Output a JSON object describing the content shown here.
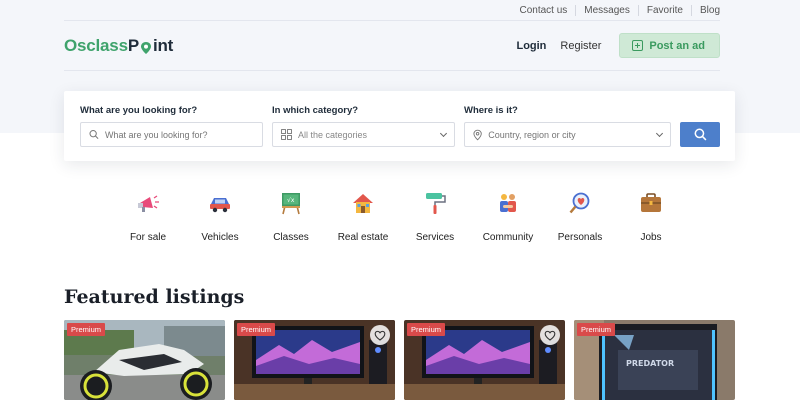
{
  "util_links": [
    "Contact us",
    "Messages",
    "Favorite",
    "Blog"
  ],
  "logo": {
    "part1": "Osclass",
    "part2": "P",
    "part3": "int"
  },
  "nav": {
    "login": "Login",
    "register": "Register",
    "post_ad": "Post an ad"
  },
  "search": {
    "what_label": "What are you looking for?",
    "what_placeholder": "What are you looking for?",
    "category_label": "In which category?",
    "category_value": "All the categories",
    "where_label": "Where is it?",
    "where_placeholder": "Country, region or city"
  },
  "categories": [
    {
      "label": "For sale",
      "icon": "megaphone-icon"
    },
    {
      "label": "Vehicles",
      "icon": "car-icon"
    },
    {
      "label": "Classes",
      "icon": "chalkboard-icon"
    },
    {
      "label": "Real estate",
      "icon": "house-icon"
    },
    {
      "label": "Services",
      "icon": "paint-roller-icon"
    },
    {
      "label": "Community",
      "icon": "people-icon"
    },
    {
      "label": "Personals",
      "icon": "heart-magnifier-icon"
    },
    {
      "label": "Jobs",
      "icon": "briefcase-icon"
    }
  ],
  "featured": {
    "title": "Featured listings",
    "listings": [
      {
        "badge": "Premium",
        "image": "motorcycle"
      },
      {
        "badge": "Premium",
        "image": "desk-setup"
      },
      {
        "badge": "Premium",
        "image": "desk-setup"
      },
      {
        "badge": "Premium",
        "image": "pc-case"
      }
    ]
  },
  "colors": {
    "accent_green": "#3fa36c",
    "search_blue": "#4d7fcb",
    "premium_red": "#d94a4a"
  }
}
